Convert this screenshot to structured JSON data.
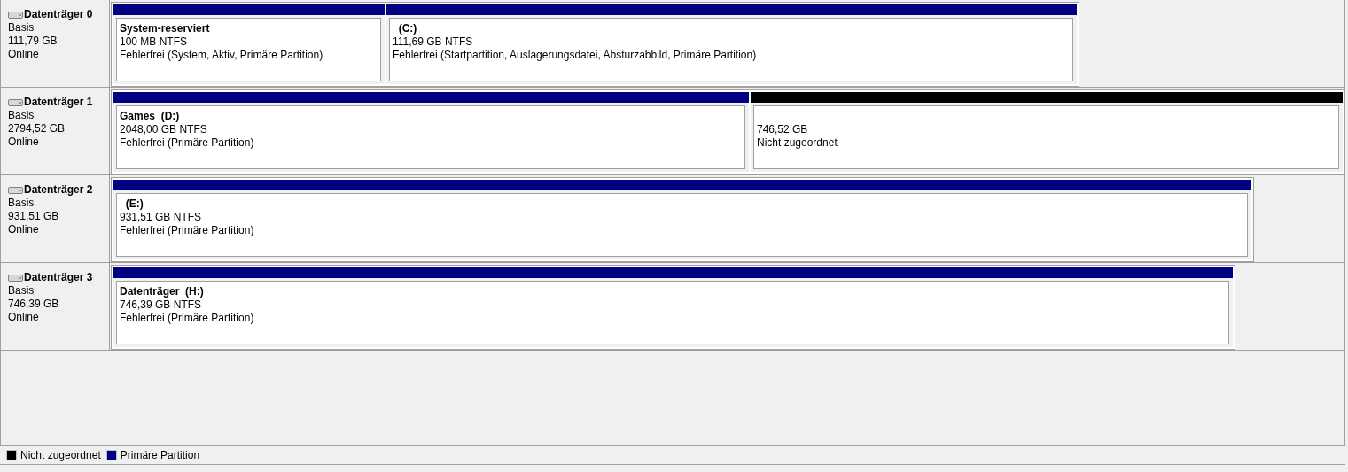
{
  "disks": [
    {
      "name": "Datenträger 0",
      "type": "Basis",
      "size": "111,79 GB",
      "status": "Online",
      "partitions": [
        {
          "kind": "primary",
          "title": "System-reserviert",
          "size": "100 MB NTFS",
          "state": "Fehlerfrei (System, Aktiv, Primäre Partition)"
        },
        {
          "kind": "primary",
          "title": "  (C:)",
          "size": "111,69 GB NTFS",
          "state": "Fehlerfrei (Startpartition, Auslagerungsdatei, Absturzabbild, Primäre Partition)"
        }
      ]
    },
    {
      "name": "Datenträger 1",
      "type": "Basis",
      "size": "2794,52 GB",
      "status": "Online",
      "partitions": [
        {
          "kind": "primary",
          "title": "Games  (D:)",
          "size": "2048,00 GB NTFS",
          "state": "Fehlerfrei (Primäre Partition)"
        },
        {
          "kind": "unallocated",
          "size": "746,52 GB",
          "state": "Nicht zugeordnet"
        }
      ]
    },
    {
      "name": "Datenträger 2",
      "type": "Basis",
      "size": "931,51 GB",
      "status": "Online",
      "partitions": [
        {
          "kind": "primary",
          "title": "  (E:)",
          "size": "931,51 GB NTFS",
          "state": "Fehlerfrei (Primäre Partition)"
        }
      ]
    },
    {
      "name": "Datenträger 3",
      "type": "Basis",
      "size": "746,39 GB",
      "status": "Online",
      "partitions": [
        {
          "kind": "primary",
          "title": "Datenträger  (H:)",
          "size": "746,39 GB NTFS",
          "state": "Fehlerfrei (Primäre Partition)"
        }
      ]
    }
  ],
  "legend": [
    {
      "kind": "unallocated",
      "label": "Nicht zugeordnet"
    },
    {
      "kind": "primary",
      "label": "Primäre Partition"
    }
  ]
}
